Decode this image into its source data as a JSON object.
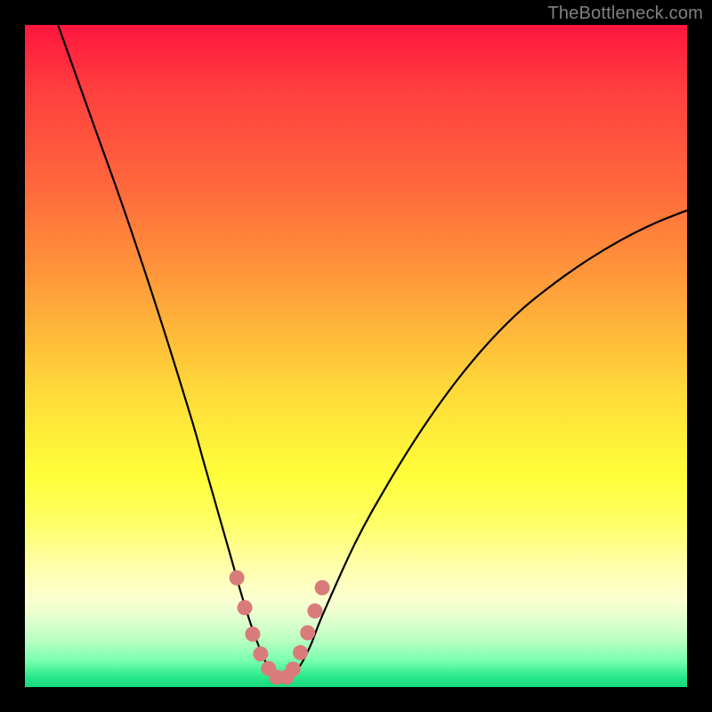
{
  "watermark": "TheBottleneck.com",
  "colors": {
    "frame": "#000000",
    "curve": "#000000",
    "marker": "#d97b7b",
    "watermark_text": "#808080"
  },
  "chart_data": {
    "type": "line",
    "title": "",
    "xlabel": "",
    "ylabel": "",
    "xlim": [
      0,
      100
    ],
    "ylim": [
      0,
      100
    ],
    "series": [
      {
        "name": "bottleneck-curve",
        "x": [
          5,
          10,
          15,
          20,
          25,
          27,
          29,
          31,
          33,
          35,
          37,
          38,
          39,
          41,
          43,
          45,
          50,
          55,
          60,
          65,
          70,
          75,
          80,
          85,
          90,
          95,
          100
        ],
        "y": [
          100,
          86,
          72,
          57,
          41,
          34,
          27,
          20,
          13,
          7,
          2.5,
          1.5,
          1.5,
          2.5,
          6,
          11,
          22,
          31,
          39,
          46,
          52,
          57,
          61,
          64.5,
          67.5,
          70,
          72
        ]
      }
    ],
    "markers": {
      "name": "highlight-dots",
      "x": [
        32.0,
        33.2,
        34.4,
        35.6,
        36.8,
        38.0,
        39.5,
        40.5,
        41.6,
        42.7,
        43.8,
        44.9
      ],
      "y": [
        16.5,
        12.0,
        8.0,
        5.0,
        2.8,
        1.5,
        1.5,
        2.7,
        5.2,
        8.2,
        11.5,
        15.0
      ]
    },
    "background_gradient": {
      "type": "vertical",
      "stops": [
        {
          "pos": 0.0,
          "color": "#ff163e"
        },
        {
          "pos": 0.25,
          "color": "#ff6a3c"
        },
        {
          "pos": 0.55,
          "color": "#ffd93a"
        },
        {
          "pos": 0.8,
          "color": "#ffff9a"
        },
        {
          "pos": 0.93,
          "color": "#b8ffc0"
        },
        {
          "pos": 1.0,
          "color": "#16d87a"
        }
      ]
    }
  }
}
